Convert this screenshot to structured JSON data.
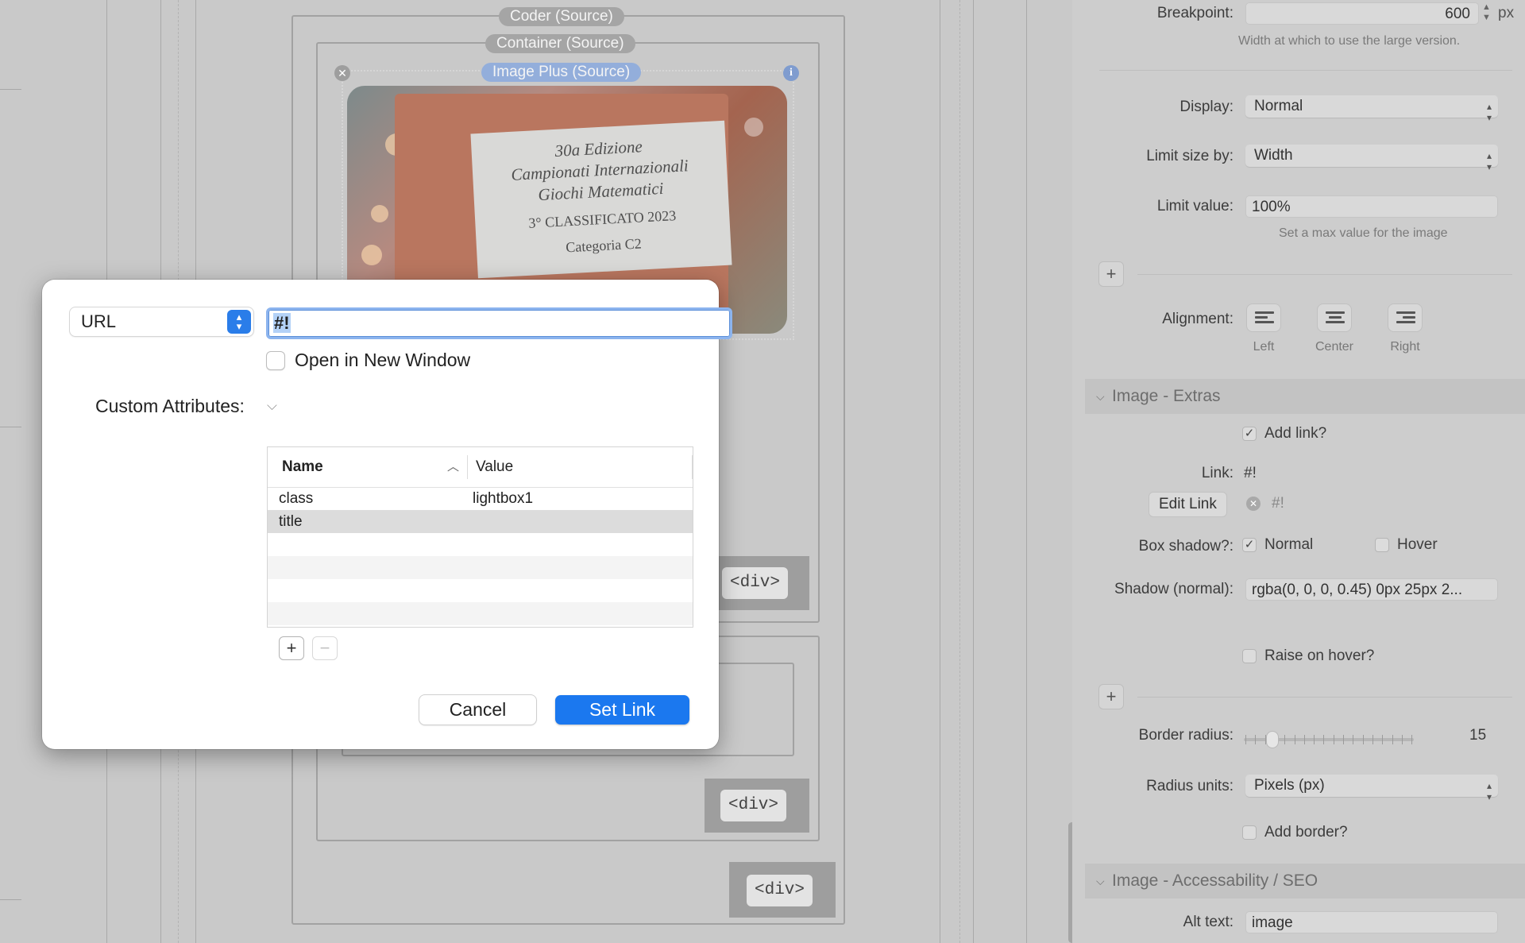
{
  "canvas": {
    "pills": {
      "coder": "Coder (Source)",
      "container": "Container (Source)",
      "image_plus": "Image Plus (Source)"
    },
    "plaque": {
      "line1": "30a Edizione",
      "line2": "Campionati Internazionali",
      "line3": "Giochi Matematici",
      "line4": "3° CLASSIFICATO 2023",
      "line5": "Categoria C2"
    },
    "div_tag": "<div>"
  },
  "inspector": {
    "breakpoint": {
      "label": "Breakpoint:",
      "value": "600",
      "unit": "px",
      "hint": "Width at which to use the large version."
    },
    "display": {
      "label": "Display:",
      "value": "Normal"
    },
    "limit_size_by": {
      "label": "Limit size by:",
      "value": "Width"
    },
    "limit_value": {
      "label": "Limit value:",
      "value": "100%",
      "hint": "Set a max value for the image"
    },
    "alignment": {
      "label": "Alignment:",
      "left": "Left",
      "center": "Center",
      "right": "Right"
    },
    "extras_section": "Image - Extras",
    "add_link": {
      "label": "Add link?",
      "checked": true
    },
    "link": {
      "label": "Link:",
      "value": "#!"
    },
    "edit_link": {
      "button": "Edit Link",
      "value": "#!"
    },
    "box_shadow": {
      "label": "Box shadow?:",
      "normal_label": "Normal",
      "normal_checked": true,
      "hover_label": "Hover",
      "hover_checked": false
    },
    "shadow_normal": {
      "label": "Shadow (normal):",
      "value": "rgba(0, 0, 0, 0.45) 0px 25px 2..."
    },
    "raise_on_hover": {
      "label": "Raise on hover?",
      "checked": false
    },
    "border_radius": {
      "label": "Border radius:",
      "value": "15"
    },
    "radius_units": {
      "label": "Radius units:",
      "value": "Pixels (px)"
    },
    "add_border": {
      "label": "Add border?",
      "checked": false
    },
    "seo_section": "Image - Accessability / SEO",
    "alt_text": {
      "label": "Alt text:",
      "value": "image"
    }
  },
  "dialog": {
    "link_type": "URL",
    "url_value": "#!",
    "open_new_window": {
      "label": "Open in New Window",
      "checked": false
    },
    "custom_attributes_label": "Custom Attributes:",
    "table": {
      "columns": [
        "Name",
        "Value"
      ],
      "rows": [
        {
          "name": "class",
          "value": "lightbox1"
        },
        {
          "name": "title",
          "value": ""
        }
      ]
    },
    "add_row": "+",
    "remove_row": "−",
    "cancel": "Cancel",
    "set_link": "Set Link"
  }
}
